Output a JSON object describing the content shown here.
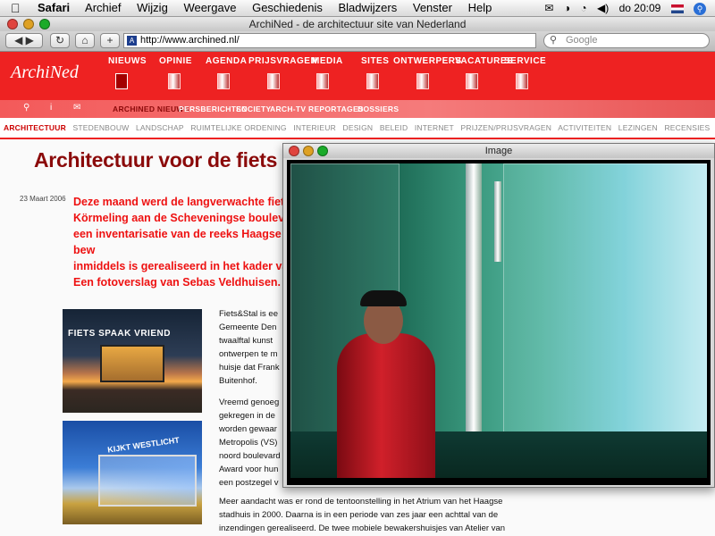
{
  "menubar": {
    "apple": "",
    "app": "Safari",
    "menus": [
      "Archief",
      "Wijzig",
      "Weergave",
      "Geschiedenis",
      "Bladwijzers",
      "Venster",
      "Help"
    ],
    "clock": "do 20:09"
  },
  "browser": {
    "title": "ArchiNed - de architectuur site van Nederland",
    "url": "http://www.archined.nl/",
    "search_placeholder": "Google"
  },
  "site": {
    "logo": "ArchiNed",
    "nav": [
      "NIEUWS",
      "OPINIE",
      "AGENDA",
      "PRIJSVRAGEN",
      "MEDIA",
      "SITES",
      "ONTWERPERS",
      "VACATURES",
      "SERVICE"
    ],
    "subnav_icons": [
      "search-icon",
      "info-icon",
      "mail-icon"
    ],
    "subnav_icon_glyphs": [
      "⚲",
      "i",
      "✉"
    ],
    "subnav": [
      "ARCHINED NIEUWS",
      "PERSBERICHTEN",
      "SOCIETY",
      "ARCH-TV",
      "REPORTAGES",
      "DOSSIERS"
    ],
    "categories": [
      "ARCHITECTUUR",
      "STEDENBOUW",
      "LANDSCHAP",
      "RUIMTELIJKE ORDENING",
      "INTERIEUR",
      "DESIGN",
      "BELEID",
      "INTERNET",
      "PRIJZEN/PRIJSVRAGEN",
      "ACTIVITEITEN",
      "LEZINGEN",
      "RECENSIES"
    ],
    "accent": "#ee2222"
  },
  "article": {
    "title": "Architectuur voor de fiets",
    "date": "23 Maart 2006",
    "lead": "Deze maand werd de langverwachte fietsen\nKörmeling aan de Scheveningse boulevard\neen inventarisatie van de reeks Haagse bew\ninmiddels is gerealiseerd in het kader van h\nEen fotoverslag van Sebas Veldhuisen.",
    "photo1_sign": "FIETS SPAAK VRIEND",
    "photo2_sign": "KIJKT WESTLICHT",
    "para1": [
      "Fiets&Stal is ee",
      "Gemeente Den",
      "twaalftal kunst",
      "ontwerpen te m",
      "huisje dat Frank",
      "Buitenhof."
    ],
    "para2": [
      "Vreemd genoeg",
      "gekregen in de",
      "worden gewaar",
      "Metropolis (VS)",
      "noord boulevard",
      "Award voor hun",
      "een postzegel v"
    ],
    "para3": [
      "Meer aandacht was er rond de tentoonstelling in het Atrium van het Haagse",
      "stadhuis in 2000. Daarna is in een periode van zes jaar een achttal van de",
      "inzendingen gerealiseerd. De twee mobiele bewakershuisjes van Atelier van"
    ]
  },
  "image_window": {
    "title": "Image"
  }
}
